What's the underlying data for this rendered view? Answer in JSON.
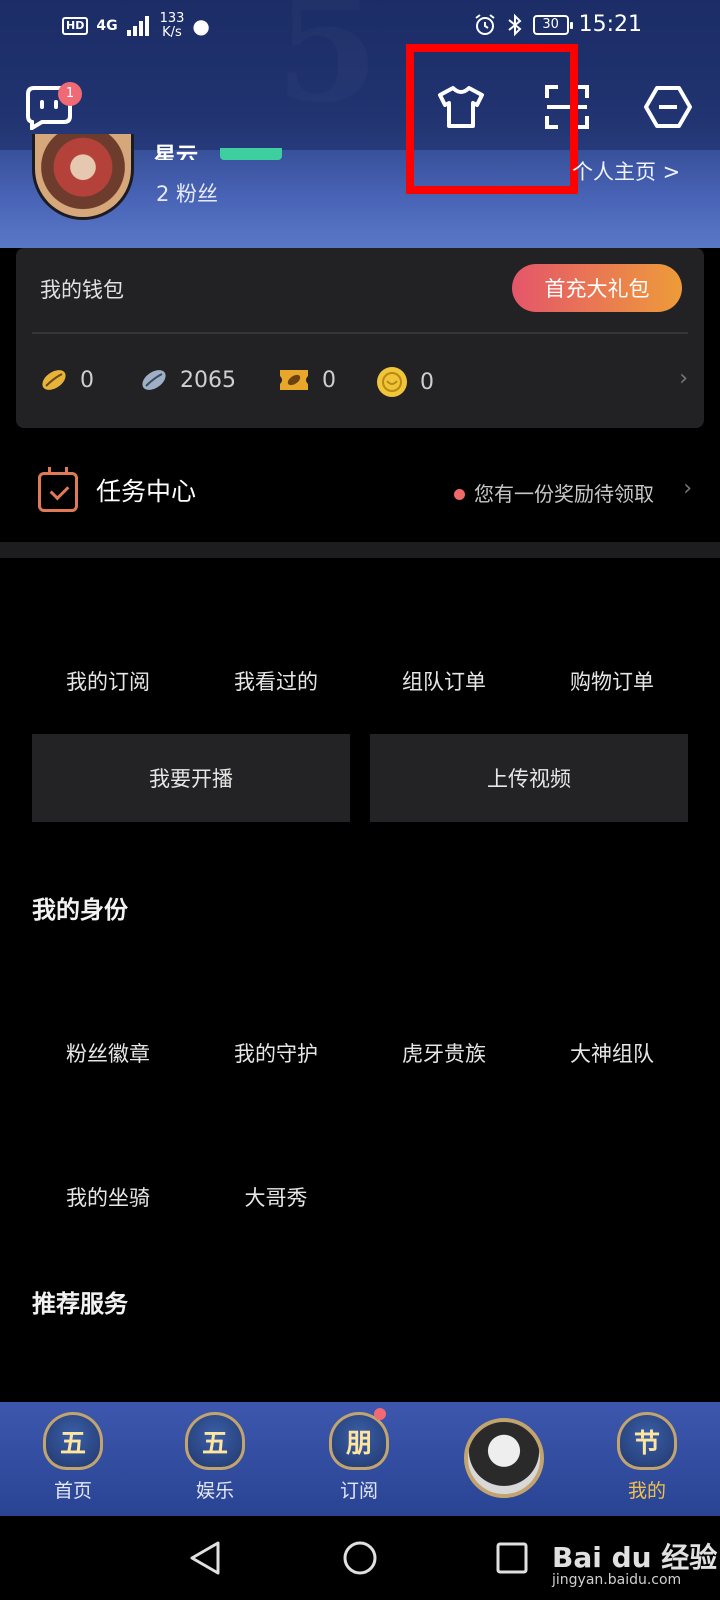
{
  "status_bar": {
    "hd": "HD",
    "signal": "4G",
    "speed_value": "133",
    "speed_unit": "K/s",
    "battery": "30",
    "time": "15:21"
  },
  "topbar": {
    "message_badge": "1"
  },
  "profile": {
    "nickname": "星云",
    "fans": "2 粉丝",
    "homepage_link": "个人主页 >"
  },
  "wallet": {
    "title": "我的钱包",
    "gift_button": "首充大礼包",
    "currencies": [
      {
        "name": "gold-bean",
        "value": "0",
        "color": "#e8b33a"
      },
      {
        "name": "silver-bean",
        "value": "2065",
        "color": "#9fb0c6"
      },
      {
        "name": "ticket",
        "value": "0",
        "color": "#e8a62a"
      },
      {
        "name": "coin",
        "value": "0",
        "color": "#f0c53a"
      }
    ]
  },
  "task_center": {
    "title": "任务中心",
    "tip": "您有一份奖励待领取"
  },
  "quick_links": [
    "我的订阅",
    "我看过的",
    "组队订单",
    "购物订单"
  ],
  "big_buttons": {
    "live": "我要开播",
    "upload": "上传视频"
  },
  "identity": {
    "title": "我的身份",
    "row1": [
      "粉丝徽章",
      "我的守护",
      "虎牙贵族",
      "大神组队"
    ],
    "row2": [
      "我的坐骑",
      "大哥秀"
    ]
  },
  "recommend": {
    "title": "推荐服务"
  },
  "bottom_nav": {
    "items": [
      {
        "emblem": "五",
        "label": "首页"
      },
      {
        "emblem": "五",
        "label": "娱乐"
      },
      {
        "emblem": "朋",
        "label": "订阅"
      },
      {
        "emblem": "节",
        "label": "我的"
      }
    ],
    "active_color": "#f2c04a"
  },
  "watermark": {
    "brand": "Bai du 经验",
    "url": "jingyan.baidu.com"
  }
}
